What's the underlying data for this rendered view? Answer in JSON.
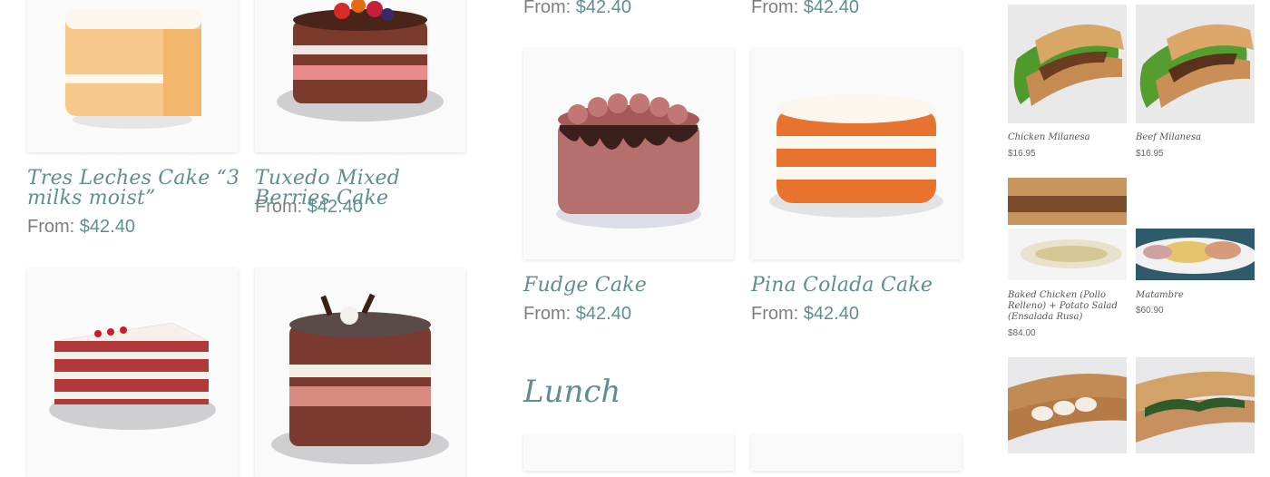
{
  "colors": {
    "accent": "#5f8e8f",
    "text": "#7f7f7f"
  },
  "top_prices": [
    {
      "prefix": "From:",
      "amount": "$42.40"
    },
    {
      "prefix": "From:",
      "amount": "$42.40"
    }
  ],
  "cakes": [
    {
      "name": "Tres Leches Cake “3 milks moist”",
      "prefix": "From:",
      "amount": "$42.40",
      "image": "tres-leches-cake-image"
    },
    {
      "name": "Tuxedo Mixed Berries Cake",
      "prefix": "From:",
      "amount": "$42.40",
      "image": "tuxedo-berries-cake-image"
    },
    {
      "name": "Fudge Cake",
      "prefix": "From:",
      "amount": "$42.40",
      "image": "fudge-cake-image"
    },
    {
      "name": "Pina Colada Cake",
      "prefix": "From:",
      "amount": "$42.40",
      "image": "pina-colada-cake-image"
    }
  ],
  "section": {
    "title": "Lunch"
  },
  "sidebar": {
    "products": [
      {
        "name": "Chicken Milanesa",
        "price": "$16.95"
      },
      {
        "name": "Beef Milanesa",
        "price": "$16.95"
      },
      {
        "name": "Baked Chicken (Pollo Relleno) + Potato Salad (Ensalada Rusa)",
        "price": "$84.00"
      },
      {
        "name": "Matambre",
        "price": "$60.90"
      }
    ]
  }
}
